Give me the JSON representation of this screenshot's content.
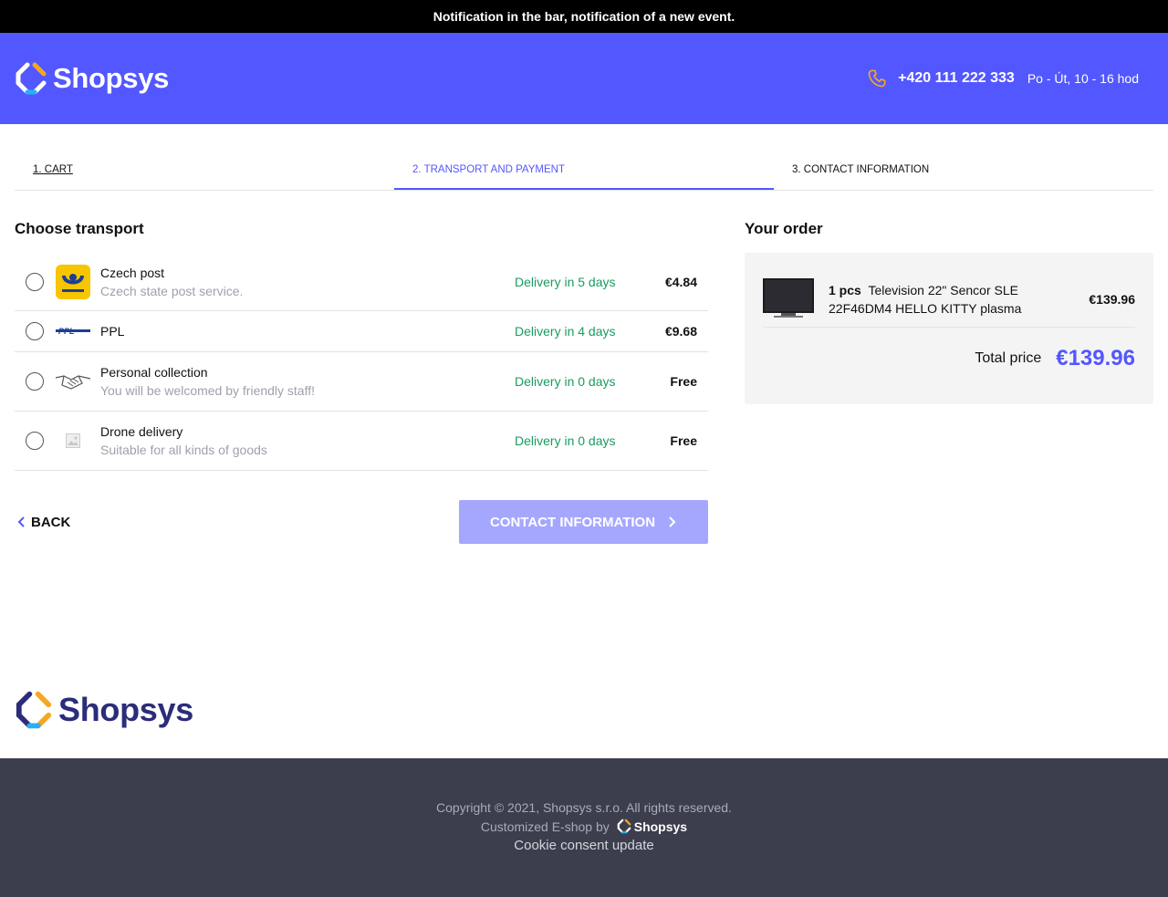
{
  "notification": "Notification in the bar, notification of a new event.",
  "brand": {
    "name": "Shopsys"
  },
  "header": {
    "phone": "+420 111 222 333",
    "hours": "Po - Út, 10 - 16 hod"
  },
  "steps": [
    {
      "label": "1. Cart",
      "state": "done"
    },
    {
      "label": "2. Transport and payment",
      "state": "active"
    },
    {
      "label": "3. Contact information",
      "state": "pending"
    }
  ],
  "transport": {
    "title": "Choose transport",
    "options": [
      {
        "name": "Czech post",
        "desc": "Czech state post service.",
        "delivery": "Delivery in 5 days",
        "price": "€4.84",
        "icon": "czech-post-logo"
      },
      {
        "name": "PPL",
        "desc": "",
        "delivery": "Delivery in 4 days",
        "price": "€9.68",
        "icon": "ppl-logo"
      },
      {
        "name": "Personal collection",
        "desc": "You will be welcomed by friendly staff!",
        "delivery": "Delivery in 0 days",
        "price": "Free",
        "icon": "handshake-icon"
      },
      {
        "name": "Drone delivery",
        "desc": "Suitable for all kinds of goods",
        "delivery": "Delivery in 0 days",
        "price": "Free",
        "icon": "image-placeholder-icon"
      }
    ]
  },
  "actions": {
    "back": "Back",
    "next": "Contact information"
  },
  "order": {
    "title": "Your order",
    "item": {
      "qty": "1 pcs",
      "name": "Television 22\" Sencor SLE 22F46DM4 HELLO KITTY plasma",
      "price": "€139.96"
    },
    "total_label": "Total price",
    "total_value": "€139.96"
  },
  "footer": {
    "copyright": "Copyright © 2021, Shopsys s.r.o. All rights reserved.",
    "customized": "Customized E-shop by",
    "cookie": "Cookie consent update"
  },
  "colors": {
    "accent": "#5357ff",
    "delivery_green": "#1a9b5f",
    "footer_bg": "#3d3e4d",
    "phone_icon": "#f5a623"
  }
}
